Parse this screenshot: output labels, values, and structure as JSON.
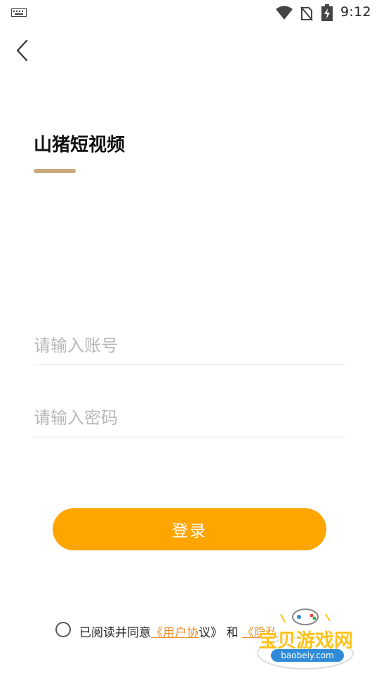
{
  "status_bar": {
    "time": "9:12",
    "icons": [
      "keyboard-icon",
      "wifi-icon",
      "no-sim-icon",
      "battery-charging-icon"
    ]
  },
  "nav": {
    "back_icon": "chevron-left-icon"
  },
  "header": {
    "title": "山猪短视频",
    "accent_color": "#C7A97C"
  },
  "form": {
    "account_placeholder": "请输入账号",
    "account_value": "",
    "password_placeholder": "请输入密码",
    "password_value": ""
  },
  "login_button": {
    "label": "登录",
    "color": "#FFA500"
  },
  "agreement": {
    "checked": false,
    "prefix": "已阅读并同意",
    "user_agreement_link": "《用户协",
    "user_agreement_rest": "议》",
    "conjunction": "和",
    "privacy_link": "《隐私"
  },
  "watermark": {
    "text": "宝贝游戏网",
    "url": "baobeiy.com"
  }
}
